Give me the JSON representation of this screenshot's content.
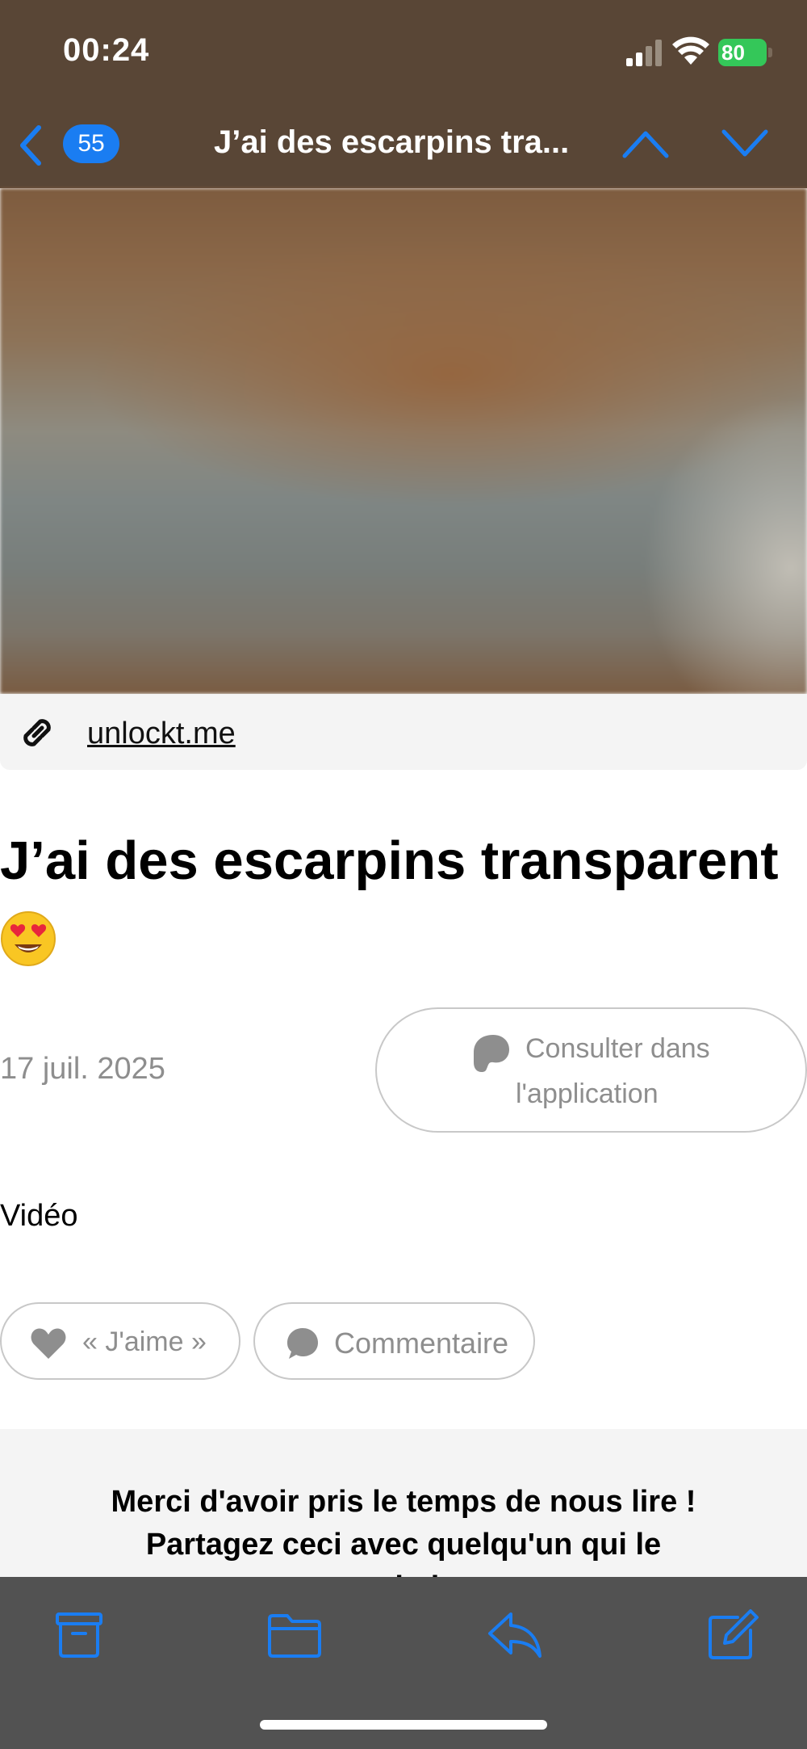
{
  "status_bar": {
    "time": "00:24",
    "battery": "80"
  },
  "nav": {
    "unread_count": "55",
    "title": "J’ai des escarpins tra..."
  },
  "link_bar": {
    "url": "unlockt.me"
  },
  "article": {
    "title": "J’ai des escarpins transparent",
    "title_emoji": "heart-eyes-emoji",
    "date": "17 juil. 2025",
    "app_button": {
      "line1": "Consulter dans",
      "line2": "l'application"
    },
    "media_label": "Vidéo",
    "like_label": "« J'aime »",
    "comment_label": "Commentaire"
  },
  "footer": {
    "line1": "Merci d'avoir pris le temps de nous lire !",
    "line2": "Partagez ceci avec quelqu'un qui le",
    "line3": "souhaite"
  },
  "toolbar": {
    "icons": [
      "archive-icon",
      "folder-icon",
      "reply-icon",
      "compose-icon"
    ]
  },
  "colors": {
    "header_bg": "#594636",
    "accent": "#1a7df2",
    "battery": "#34c759",
    "toolbar_bg": "#525252",
    "muted_text": "#8e8e8e"
  }
}
